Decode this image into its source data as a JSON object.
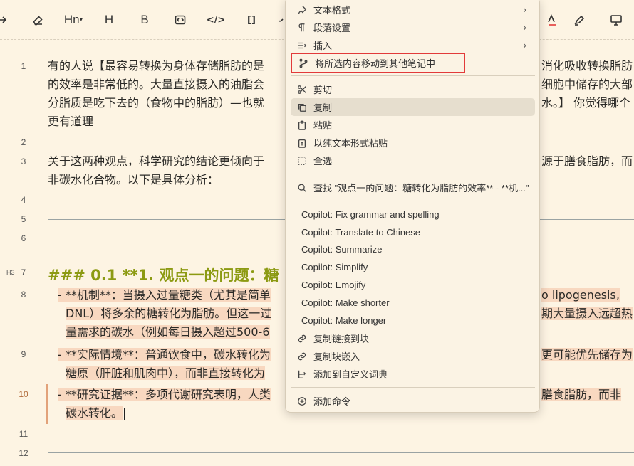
{
  "toolbar": {
    "heading_n": "Hn",
    "heading_h": "H",
    "bold": "B",
    "code": "</>",
    "bracket": "[]"
  },
  "editor": {
    "line_numbers": [
      "1",
      "2",
      "3",
      "4",
      "5",
      "6",
      "7",
      "8",
      "9",
      "10",
      "11",
      "12"
    ],
    "h3_tag": "H3",
    "lines": {
      "l1a": "有的人说【最容易转换为身体存储脂肪的是",
      "l1a_right": "消化吸收转换脂肪",
      "l1b": "的效率是非常低的。大量直接摄入的油脂会",
      "l1b_right": "细胞中储存的大部",
      "l1c": "分脂质是吃下去的（食物中的脂肪）—也就",
      "l1c_right": "水。】 你觉得哪个",
      "l1d": "更有道理",
      "l3a": "关于这两种观点，科学研究的结论更倾向于",
      "l3a_right": "源于膳食脂肪，而",
      "l3b": "非碳水化合物。以下是具体分析：",
      "heading": "### 0.1 **1. 观点一的问题：糖",
      "b8a": "- **机制**：当摄入过量糖类（尤其是简单",
      "b8a_right": "o lipogenesis,",
      "b8b": "DNL）将多余的糖转化为脂肪。但这一过",
      "b8b_right": "期大量摄入远超热",
      "b8c": "量需求的碳水（例如每日摄入超过500-6",
      "b9a": "- **实际情境**：普通饮食中，碳水转化为",
      "b9a_right": "更可能优先储存为",
      "b9b": "糖原（肝脏和肌肉中），而非直接转化为",
      "b10a": "- **研究证据**：多项代谢研究表明，人类",
      "b10a_right": "膳食脂肪，而非",
      "b10b": "碳水转化。"
    }
  },
  "menu": {
    "items": [
      {
        "label": "文本格式",
        "icon": "paintbrush-icon",
        "submenu": true
      },
      {
        "label": "段落设置",
        "icon": "pilcrow-icon",
        "submenu": true
      },
      {
        "label": "插入",
        "icon": "insert-icon",
        "submenu": true
      },
      {
        "label": "将所选内容移动到其他笔记中",
        "icon": "git-branch-icon"
      },
      {
        "label": "剪切",
        "icon": "scissors-icon"
      },
      {
        "label": "复制",
        "icon": "copy-icon"
      },
      {
        "label": "粘贴",
        "icon": "clipboard-icon"
      },
      {
        "label": "以纯文本形式粘贴",
        "icon": "clipboard-text-icon"
      },
      {
        "label": "全选",
        "icon": "select-all-icon"
      },
      {
        "label": "查找 \"观点一的问题：糖转化为脂肪的效率** - **机...\"",
        "icon": "search-icon"
      },
      {
        "label": "Copilot: Fix grammar and spelling"
      },
      {
        "label": "Copilot: Translate to Chinese"
      },
      {
        "label": "Copilot: Summarize"
      },
      {
        "label": "Copilot: Simplify"
      },
      {
        "label": "Copilot: Emojify"
      },
      {
        "label": "Copilot: Make shorter"
      },
      {
        "label": "Copilot: Make longer"
      },
      {
        "label": "复制链接到块",
        "icon": "link-icon"
      },
      {
        "label": "复制块嵌入",
        "icon": "link-icon"
      },
      {
        "label": "添加到自定义词典",
        "icon": "dictionary-icon"
      },
      {
        "label": "添加命令",
        "icon": "plus-circle-icon"
      }
    ]
  },
  "colors": {
    "background": "#fdf4e3",
    "heading": "#8c9a12",
    "highlight": "#f8d8c0",
    "menu_bg": "#fbf3e4",
    "outline": "#e23a3a"
  }
}
